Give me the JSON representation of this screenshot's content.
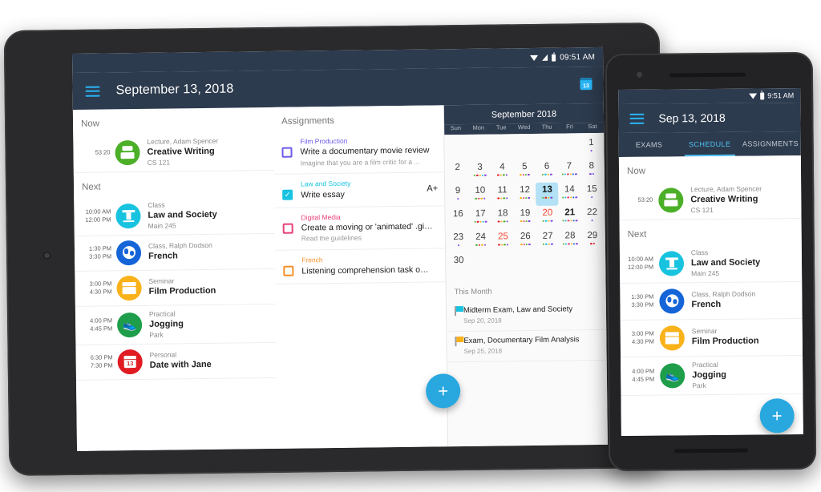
{
  "tablet": {
    "statusbar": {
      "time": "09:51 AM",
      "icons": [
        "wifi-icon",
        "signal-icon",
        "battery-icon"
      ]
    },
    "appbar": {
      "menu_icon": "hamburger-icon",
      "title": "September 13, 2018",
      "calendar_icon_label": "13"
    },
    "schedule": {
      "now_label": "Now",
      "next_label": "Next",
      "now_items": [
        {
          "time1": "53:20",
          "time2": "",
          "category": "Lecture, Adam Spencer",
          "title": "Creative Writing",
          "location": "CS 121",
          "color": "#4caf28",
          "icon": "podium-icon"
        }
      ],
      "next_items": [
        {
          "time1": "10:00 AM",
          "time2": "12:00 PM",
          "category": "Class",
          "title": "Law and Society",
          "location": "Main 245",
          "color": "#18c3e0",
          "icon": "pillar-icon"
        },
        {
          "time1": "1:30 PM",
          "time2": "3:30 PM",
          "category": "Class, Ralph Dodson",
          "title": "French",
          "location": "",
          "color": "#1565d8",
          "icon": "globe-icon"
        },
        {
          "time1": "3:00 PM",
          "time2": "4:30 PM",
          "category": "Seminar",
          "title": "Film Production",
          "location": "",
          "color": "#f9b21a",
          "icon": "clapperboard-icon"
        },
        {
          "time1": "4:00 PM",
          "time2": "4:45 PM",
          "category": "Practical",
          "title": "Jogging",
          "location": "Park",
          "color": "#1e9e4a",
          "icon": "shoe-icon"
        },
        {
          "time1": "6:30 PM",
          "time2": "7:30 PM",
          "category": "Personal",
          "title": "Date with Jane",
          "location": "",
          "color": "#e11b22",
          "icon": "calendar-date-icon"
        }
      ]
    },
    "assignments": {
      "header": "Assignments",
      "items": [
        {
          "course": "Film Production",
          "course_color": "#6b5be8",
          "title": "Write a documentary movie review",
          "desc": "Imagine that you are a film critic for a ...",
          "checked": false,
          "grade": ""
        },
        {
          "course": "Law and Society",
          "course_color": "#18c3e0",
          "title": "Write essay",
          "desc": "",
          "checked": true,
          "grade": "A+"
        },
        {
          "course": "Digital Media",
          "course_color": "#e8407a",
          "title": "Create a moving or 'animated' .gi…",
          "desc": "Read the guidelines",
          "checked": false,
          "grade": ""
        },
        {
          "course": "French",
          "course_color": "#f5902b",
          "title": "Listening comprehension task o…",
          "desc": "",
          "checked": false,
          "grade": ""
        }
      ]
    },
    "calendar": {
      "month_title": "September 2018",
      "dow": [
        "Sun",
        "Mon",
        "Tue",
        "Wed",
        "Thu",
        "Fri",
        "Sat"
      ],
      "today": 13,
      "red_days": [
        20,
        25
      ],
      "bold_days": [
        21
      ],
      "days": [
        {
          "n": "",
          "dots": []
        },
        {
          "n": "",
          "dots": []
        },
        {
          "n": "",
          "dots": []
        },
        {
          "n": "",
          "dots": []
        },
        {
          "n": "",
          "dots": []
        },
        {
          "n": "",
          "dots": []
        },
        {
          "n": "1",
          "dots": [
            "#7b3fe4"
          ]
        },
        {
          "n": "2",
          "dots": []
        },
        {
          "n": "3",
          "dots": [
            "#4caf28",
            "#e11b22",
            "#f9b21a",
            "#18c3e0",
            "#7b3fe4"
          ]
        },
        {
          "n": "4",
          "dots": [
            "#e11b22",
            "#f9b21a",
            "#4caf28",
            "#7b3fe4"
          ]
        },
        {
          "n": "5",
          "dots": [
            "#f9b21a",
            "#e8407a",
            "#4caf28",
            "#7b3fe4"
          ]
        },
        {
          "n": "6",
          "dots": [
            "#4caf28",
            "#18c3e0",
            "#f9b21a",
            "#7b3fe4"
          ]
        },
        {
          "n": "7",
          "dots": [
            "#4caf28",
            "#18c3e0",
            "#e8407a",
            "#f9b21a",
            "#1565d8",
            "#7b3fe4"
          ]
        },
        {
          "n": "8",
          "dots": [
            "#7b3fe4",
            "#7b3fe4"
          ]
        },
        {
          "n": "9",
          "dots": [
            "#7b3fe4"
          ]
        },
        {
          "n": "10",
          "dots": [
            "#4caf28",
            "#e11b22",
            "#f9b21a",
            "#7b3fe4"
          ]
        },
        {
          "n": "11",
          "dots": [
            "#e11b22",
            "#f9b21a",
            "#4caf28",
            "#7b3fe4"
          ]
        },
        {
          "n": "12",
          "dots": [
            "#f9b21a",
            "#e8407a",
            "#4caf28",
            "#7b3fe4"
          ]
        },
        {
          "n": "13",
          "dots": [
            "#4caf28",
            "#e11b22",
            "#f9b21a",
            "#7b3fe4"
          ]
        },
        {
          "n": "14",
          "dots": [
            "#4caf28",
            "#18c3e0",
            "#e8407a",
            "#f9b21a",
            "#1565d8",
            "#7b3fe4"
          ]
        },
        {
          "n": "15",
          "dots": [
            "#7b3fe4"
          ]
        },
        {
          "n": "16",
          "dots": []
        },
        {
          "n": "17",
          "dots": [
            "#4caf28",
            "#e11b22",
            "#f9b21a",
            "#18c3e0",
            "#7b3fe4"
          ]
        },
        {
          "n": "18",
          "dots": [
            "#e11b22",
            "#f9b21a",
            "#4caf28",
            "#7b3fe4"
          ]
        },
        {
          "n": "19",
          "dots": [
            "#f9b21a",
            "#e8407a",
            "#4caf28",
            "#7b3fe4"
          ]
        },
        {
          "n": "20",
          "dots": [
            "#4caf28",
            "#18c3e0",
            "#f9b21a",
            "#7b3fe4"
          ]
        },
        {
          "n": "21",
          "dots": [
            "#4caf28",
            "#18c3e0",
            "#e8407a",
            "#f9b21a",
            "#1565d8",
            "#7b3fe4"
          ]
        },
        {
          "n": "22",
          "dots": [
            "#7b3fe4"
          ]
        },
        {
          "n": "23",
          "dots": [
            "#7b3fe4"
          ]
        },
        {
          "n": "24",
          "dots": [
            "#4caf28",
            "#e11b22",
            "#f9b21a",
            "#7b3fe4"
          ]
        },
        {
          "n": "25",
          "dots": [
            "#e11b22",
            "#f9b21a",
            "#4caf28",
            "#7b3fe4"
          ]
        },
        {
          "n": "26",
          "dots": [
            "#f9b21a",
            "#e8407a",
            "#4caf28",
            "#7b3fe4"
          ]
        },
        {
          "n": "27",
          "dots": [
            "#4caf28",
            "#18c3e0",
            "#f9b21a",
            "#7b3fe4"
          ]
        },
        {
          "n": "28",
          "dots": [
            "#4caf28",
            "#18c3e0",
            "#e8407a",
            "#f9b21a",
            "#1565d8",
            "#7b3fe4"
          ]
        },
        {
          "n": "29",
          "dots": [
            "#e11b22",
            "#e11b22"
          ]
        },
        {
          "n": "30",
          "dots": []
        }
      ],
      "this_month_label": "This Month",
      "events": [
        {
          "title": "Midterm Exam, Law and Society",
          "date": "Sep 20, 2018",
          "flag_color": "#18c3e0"
        },
        {
          "title": "Exam, Documentary Film Analysis",
          "date": "Sep 25, 2018",
          "flag_color": "#f9b21a"
        }
      ]
    },
    "fab_label": "+",
    "navbar": {
      "back": "back-icon",
      "home": "home-icon",
      "recents": "recents-icon"
    }
  },
  "phone": {
    "statusbar": {
      "time": "9:51 AM"
    },
    "appbar": {
      "menu_icon": "hamburger-icon",
      "title": "Sep 13, 2018"
    },
    "tabs": [
      {
        "label": "EXAMS",
        "active": false
      },
      {
        "label": "SCHEDULE",
        "active": true
      },
      {
        "label": "ASSIGNMENTS",
        "active": false
      }
    ],
    "schedule": {
      "now_label": "Now",
      "next_label": "Next",
      "now_items": [
        {
          "time1": "53:20",
          "time2": "",
          "category": "Lecture, Adam Spencer",
          "title": "Creative Writing",
          "location": "CS 121",
          "color": "#4caf28",
          "icon": "podium-icon"
        }
      ],
      "next_items": [
        {
          "time1": "10:00 AM",
          "time2": "12:00 PM",
          "category": "Class",
          "title": "Law and Society",
          "location": "Main 245",
          "color": "#18c3e0",
          "icon": "pillar-icon"
        },
        {
          "time1": "1:30 PM",
          "time2": "3:30 PM",
          "category": "Class, Ralph Dodson",
          "title": "French",
          "location": "",
          "color": "#1565d8",
          "icon": "globe-icon"
        },
        {
          "time1": "3:00 PM",
          "time2": "4:30 PM",
          "category": "Seminar",
          "title": "Film Production",
          "location": "",
          "color": "#f9b21a",
          "icon": "clapperboard-icon"
        },
        {
          "time1": "4:00 PM",
          "time2": "4:45 PM",
          "category": "Practical",
          "title": "Jogging",
          "location": "Park",
          "color": "#1e9e4a",
          "icon": "shoe-icon"
        }
      ]
    },
    "fab_label": "+"
  },
  "colors": {
    "appbar": "#2d3b4e",
    "accent": "#29a8e0",
    "tab_active": "#4fc3f7",
    "today_highlight": "#b3e1f5"
  }
}
